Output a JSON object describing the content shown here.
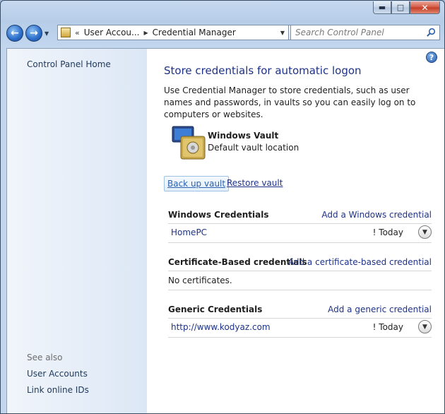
{
  "window": {
    "caption_min": "▬",
    "caption_max": "□",
    "caption_close": "✕"
  },
  "nav": {
    "back_glyph": "←",
    "forward_glyph": "→",
    "address_prefix": "«",
    "address_segments": [
      "User Accou...",
      "Credential Manager"
    ],
    "search_placeholder": "Search Control Panel"
  },
  "sidebar": {
    "home_link": "Control Panel Home",
    "see_also_label": "See also",
    "see_also_links": [
      "User Accounts",
      "Link online IDs"
    ]
  },
  "main": {
    "help_glyph": "?",
    "title": "Store credentials for automatic logon",
    "description": "Use Credential Manager to store credentials, such as user names and passwords, in vaults so you can easily log on to computers or websites.",
    "vault_name": "Windows Vault",
    "vault_desc": "Default vault location",
    "backup_label": "Back up vault",
    "restore_label": "Restore vault",
    "sections": [
      {
        "title": "Windows Credentials",
        "add_link": "Add a Windows credential",
        "items": [
          {
            "name": "HomePC",
            "date": "Today"
          }
        ]
      },
      {
        "title": "Certificate-Based credentials",
        "add_link": "Add a certificate-based credential",
        "empty_text": "No certificates."
      },
      {
        "title": "Generic Credentials",
        "add_link": "Add a generic credential",
        "items": [
          {
            "name": "http://www.kodyaz.com",
            "date": "Today"
          }
        ]
      }
    ],
    "date_marker": "!"
  },
  "colors": {
    "link": "#1e3287",
    "sidebar_gradient_start": "#f1f5fb",
    "sidebar_gradient_end": "#dce7f5",
    "window_frame": "#b6cde8"
  },
  "icons": [
    "back-arrow-icon",
    "forward-arrow-icon",
    "control-panel-icon",
    "refresh-icon",
    "search-icon",
    "help-icon",
    "windows-vault-icon",
    "expand-chevron-icon"
  ]
}
